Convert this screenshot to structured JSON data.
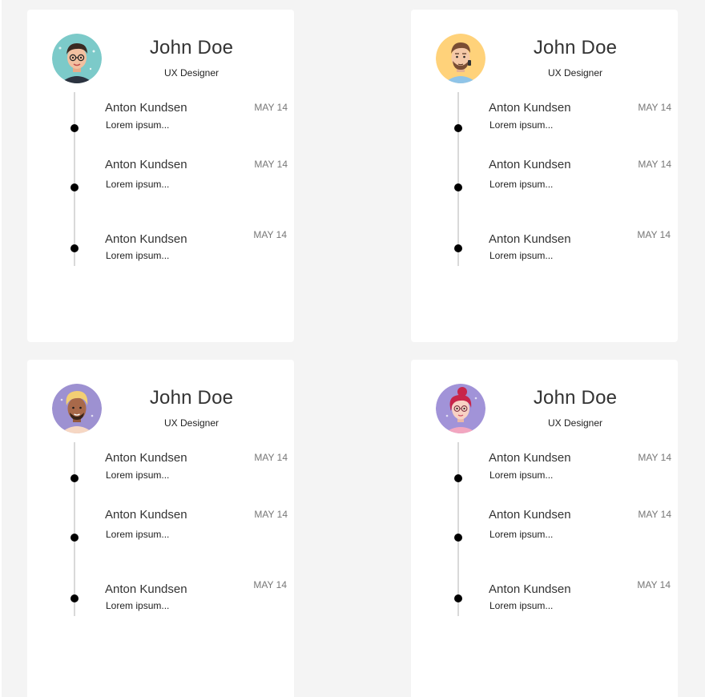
{
  "cards": [
    {
      "name": "John Doe",
      "role": "UX Designer",
      "avatar": {
        "icon": "male-avatar-dark-hair-icon",
        "bg": "#7ccac9",
        "skin": "#f2c0a0",
        "hair": "#3a2a22",
        "shirt": "#2b3340"
      },
      "timeline": [
        {
          "title": "Anton Kundsen",
          "text": "Lorem ipsum...",
          "date": "MAY 14"
        },
        {
          "title": "Anton Kundsen",
          "text": "Lorem ipsum...",
          "date": "MAY 14"
        },
        {
          "title": "Anton Kundsen",
          "text": "Lorem ipsum...",
          "date": "MAY 14"
        }
      ]
    },
    {
      "name": "John Doe",
      "role": "UX Designer",
      "avatar": {
        "icon": "male-avatar-beard-icon",
        "bg": "#ffd27a",
        "skin": "#f5c9a8",
        "hair": "#7a4e34",
        "shirt": "#8fc4e8"
      },
      "timeline": [
        {
          "title": "Anton Kundsen",
          "text": "Lorem ipsum...",
          "date": "MAY 14"
        },
        {
          "title": "Anton Kundsen",
          "text": "Lorem ipsum...",
          "date": "MAY 14"
        },
        {
          "title": "Anton Kundsen",
          "text": "Lorem ipsum...",
          "date": "MAY 14"
        }
      ]
    },
    {
      "name": "John Doe",
      "role": "UX Designer",
      "avatar": {
        "icon": "male-avatar-blonde-icon",
        "bg": "#9d91d1",
        "skin": "#a8694a",
        "hair": "#f3cf73",
        "shirt": "#f6d7c3"
      },
      "timeline": [
        {
          "title": "Anton Kundsen",
          "text": "Lorem ipsum...",
          "date": "MAY 14"
        },
        {
          "title": "Anton Kundsen",
          "text": "Lorem ipsum...",
          "date": "MAY 14"
        },
        {
          "title": "Anton Kundsen",
          "text": "Lorem ipsum...",
          "date": "MAY 14"
        }
      ]
    },
    {
      "name": "John Doe",
      "role": "UX Designer",
      "avatar": {
        "icon": "female-avatar-red-hair-icon",
        "bg": "#a193d8",
        "skin": "#f8d2c4",
        "hair": "#c8254a",
        "shirt": "#f2a6c0"
      },
      "timeline": [
        {
          "title": "Anton Kundsen",
          "text": "Lorem ipsum...",
          "date": "MAY 14"
        },
        {
          "title": "Anton Kundsen",
          "text": "Lorem ipsum...",
          "date": "MAY 14"
        },
        {
          "title": "Anton Kundsen",
          "text": "Lorem ipsum...",
          "date": "MAY 14"
        }
      ]
    }
  ]
}
